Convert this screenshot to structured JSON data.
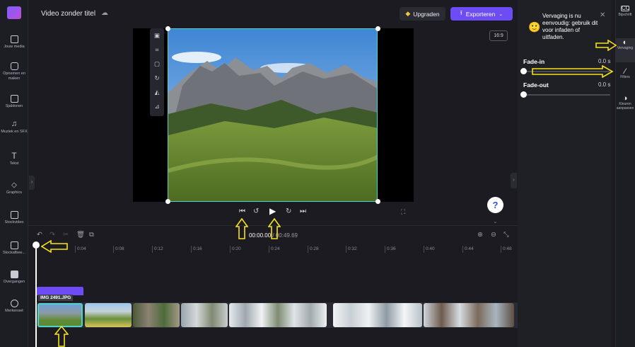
{
  "app": {
    "title": "Video zonder titel"
  },
  "header": {
    "upgrade_label": "Upgraden",
    "export_label": "Exporteren"
  },
  "left_nav": {
    "items": [
      {
        "label": "Jouw media",
        "icon": "folder-icon"
      },
      {
        "label": "Opnemen en maken",
        "icon": "camera-icon"
      },
      {
        "label": "Sjablonen",
        "icon": "templates-icon"
      },
      {
        "label": "Muziek en SFX",
        "icon": "music-icon"
      },
      {
        "label": "Tekst",
        "icon": "text-icon"
      },
      {
        "label": "Graphics",
        "icon": "shapes-icon"
      },
      {
        "label": "Stockvideo",
        "icon": "stock-video-icon"
      },
      {
        "label": "Stockafbee...",
        "icon": "stock-image-icon"
      },
      {
        "label": "Overgangen",
        "icon": "transitions-icon"
      },
      {
        "label": "Merkenset",
        "icon": "brand-kit-icon"
      }
    ]
  },
  "preview": {
    "aspect_ratio": "16:9",
    "help_label": "?"
  },
  "timeline": {
    "current_time": "00:00.00",
    "total_time": "00:49.69",
    "ticks": [
      "0:04",
      "0:08",
      "0:12",
      "0:16",
      "0:20",
      "0:24",
      "0:28",
      "0:32",
      "0:36",
      "0:40",
      "0:44",
      "0:48"
    ],
    "selected_clip_label": "IMG 2491.JPG"
  },
  "fade_panel": {
    "tip_text": "Vervaging is nu eenvoudig: gebruik dit voor infaden of uitfaden.",
    "fade_in_label": "Fade-in",
    "fade_in_value": "0.0 s",
    "fade_out_label": "Fade-out",
    "fade_out_value": "0.0 s"
  },
  "right_rail": {
    "items": [
      {
        "label": "Bijschrift",
        "icon": "captions-icon"
      },
      {
        "label": "Vervaging",
        "icon": "fade-icon"
      },
      {
        "label": "Filters",
        "icon": "filters-icon"
      },
      {
        "label": "Kleuren aanpassen",
        "icon": "color-adjust-icon"
      }
    ]
  },
  "colors": {
    "accent": "#6d4cf6",
    "selection": "#4fd0c9",
    "annotation_arrow": "#f5e31a"
  }
}
